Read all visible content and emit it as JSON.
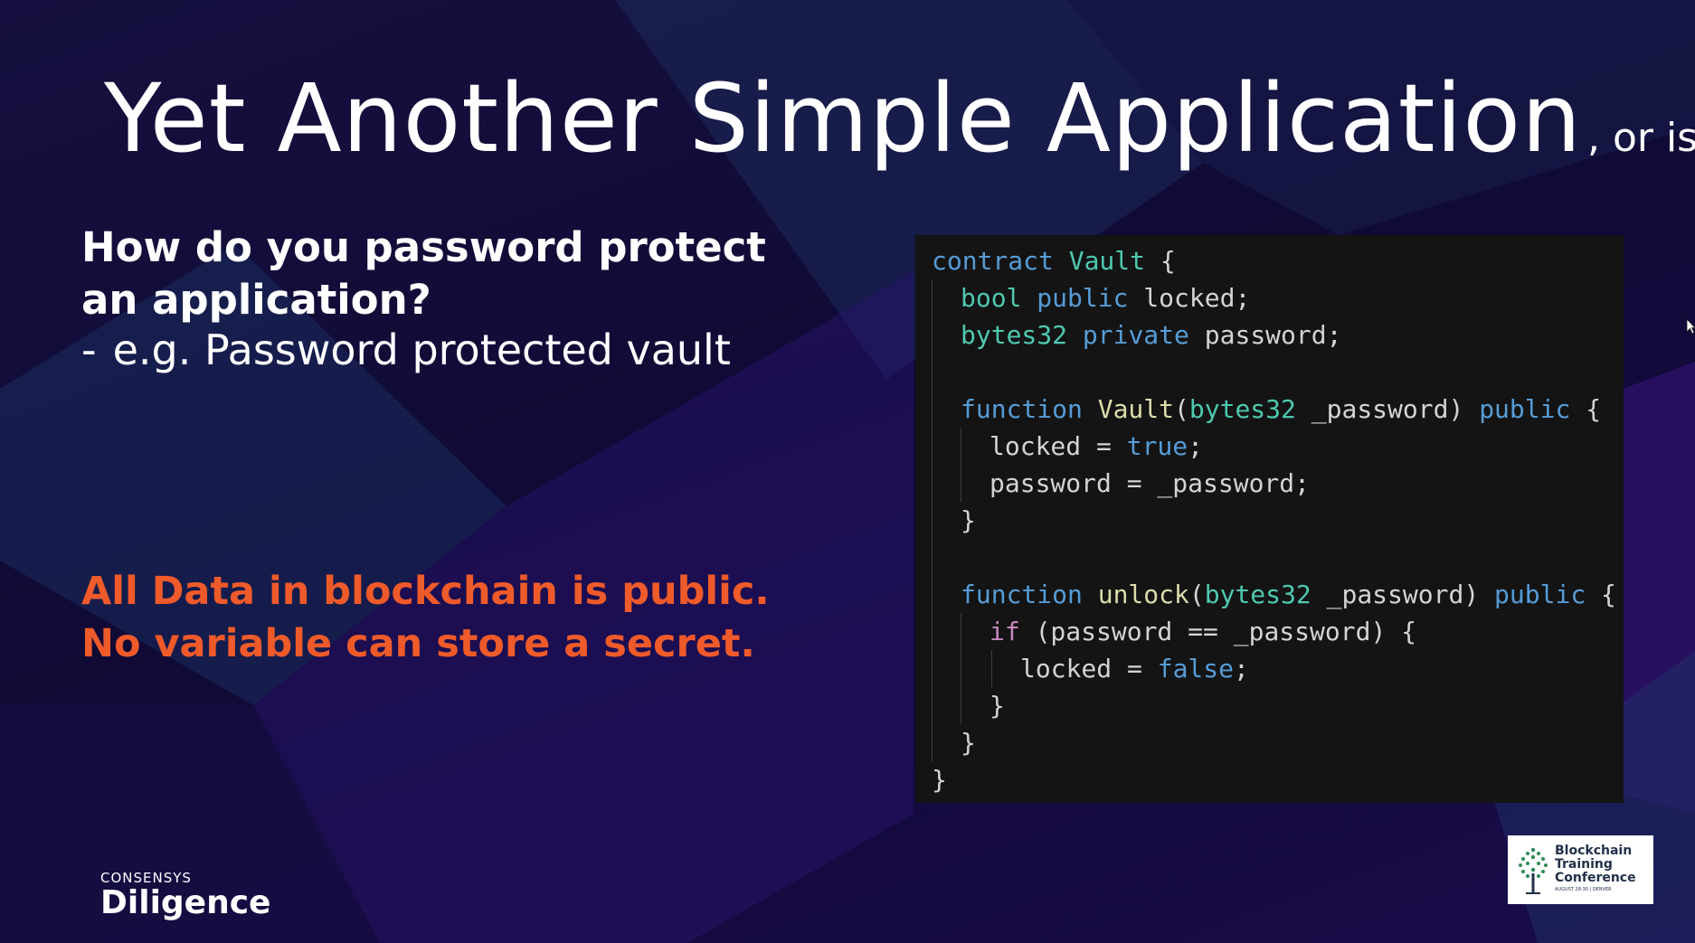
{
  "slide": {
    "title": "Yet Another Simple Application",
    "title_suffix": ", or is it?",
    "question": "How do you password protect an application?",
    "example_dash": "-",
    "example": "e.g. Password protected vault",
    "warning_line1": "All Data in blockchain is public.",
    "warning_line2": "No variable can store a secret."
  },
  "code": {
    "l1": [
      "contract",
      " Vault {"
    ],
    "l2": [
      "bool",
      "public",
      " locked;"
    ],
    "l3": [
      "bytes32",
      "private",
      " password;"
    ],
    "l5": [
      "function",
      "Vault",
      "(",
      "bytes32",
      " _password) ",
      "public",
      " {"
    ],
    "l6": [
      "locked = ",
      "true",
      ";"
    ],
    "l7": [
      "password = _password;"
    ],
    "l8": [
      "}"
    ],
    "l10": [
      "function",
      "unlock",
      "(",
      "bytes32",
      " _password) ",
      "public",
      " {"
    ],
    "l11": [
      "if",
      " (password == _password) {"
    ],
    "l12": [
      "locked = ",
      "false",
      ";"
    ],
    "l13": [
      "}"
    ],
    "l14": [
      "}"
    ],
    "l15": [
      "}"
    ]
  },
  "branding": {
    "logo_small": "CONSENSYS",
    "logo_big": "Diligence",
    "conf_line1": "Blockchain",
    "conf_line2": "Training",
    "conf_line3": "Conference",
    "conf_date": "AUGUST 28-30 | DENVER"
  },
  "colors": {
    "background": "#120b3a",
    "accent_warning": "#ef5a2a",
    "code_bg": "#141414"
  }
}
